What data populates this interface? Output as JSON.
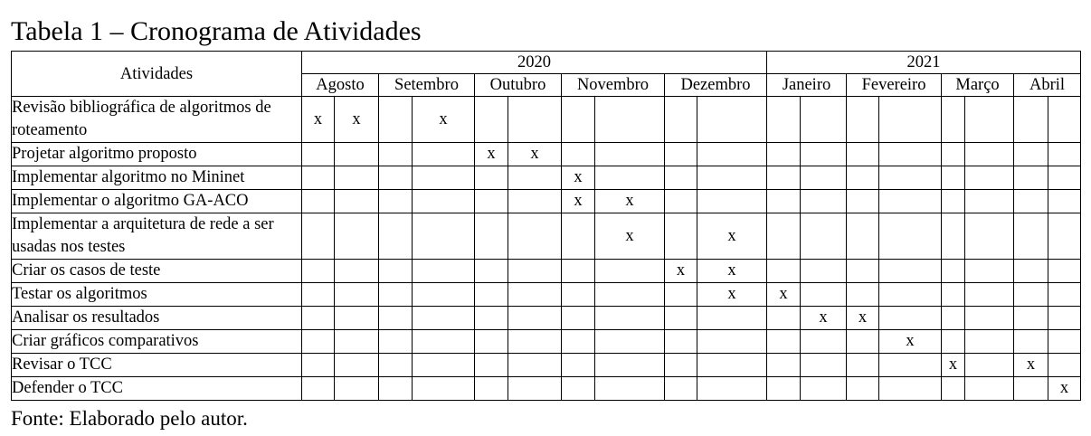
{
  "caption": "Tabela 1 – Cronograma de Atividades",
  "header": {
    "activities_label": "Atividades",
    "years": [
      "2020",
      "2021"
    ],
    "months": [
      "Agosto",
      "Setembro",
      "Outubro",
      "Novembro",
      "Dezembro",
      "Janeiro",
      "Fevereiro",
      "Março",
      "Abril"
    ]
  },
  "rows": [
    {
      "label": "Revisão bibliográfica de algoritmos de roteamento",
      "marks": [
        "x",
        "x",
        "",
        "x",
        "",
        "",
        "",
        "",
        "",
        "",
        "",
        "",
        "",
        "",
        "",
        "",
        "",
        ""
      ]
    },
    {
      "label": "Projetar algoritmo proposto",
      "marks": [
        "",
        "",
        "",
        "",
        "x",
        "x",
        "",
        "",
        "",
        "",
        "",
        "",
        "",
        "",
        "",
        "",
        "",
        ""
      ]
    },
    {
      "label": "Implementar algoritmo no Mininet",
      "marks": [
        "",
        "",
        "",
        "",
        "",
        "",
        "x",
        "",
        "",
        "",
        "",
        "",
        "",
        "",
        "",
        "",
        "",
        ""
      ]
    },
    {
      "label": "Implementar o algoritmo GA-ACO",
      "marks": [
        "",
        "",
        "",
        "",
        "",
        "",
        "x",
        "x",
        "",
        "",
        "",
        "",
        "",
        "",
        "",
        "",
        "",
        ""
      ]
    },
    {
      "label": "Implementar a arquitetura de rede a ser usadas nos testes",
      "marks": [
        "",
        "",
        "",
        "",
        "",
        "",
        "",
        "x",
        "",
        "x",
        "",
        "",
        "",
        "",
        "",
        "",
        "",
        ""
      ]
    },
    {
      "label": "Criar os casos de teste",
      "marks": [
        "",
        "",
        "",
        "",
        "",
        "",
        "",
        "",
        "x",
        "x",
        "",
        "",
        "",
        "",
        "",
        "",
        "",
        ""
      ]
    },
    {
      "label": "Testar os algoritmos",
      "marks": [
        "",
        "",
        "",
        "",
        "",
        "",
        "",
        "",
        "",
        "x",
        "x",
        "",
        "",
        "",
        "",
        "",
        "",
        ""
      ]
    },
    {
      "label": "Analisar os resultados",
      "marks": [
        "",
        "",
        "",
        "",
        "",
        "",
        "",
        "",
        "",
        "",
        "",
        "x",
        "x",
        "",
        "",
        "",
        "",
        ""
      ]
    },
    {
      "label": "Criar gráficos comparativos",
      "marks": [
        "",
        "",
        "",
        "",
        "",
        "",
        "",
        "",
        "",
        "",
        "",
        "",
        "",
        "x",
        "",
        "",
        "",
        ""
      ]
    },
    {
      "label": "Revisar o TCC",
      "marks": [
        "",
        "",
        "",
        "",
        "",
        "",
        "",
        "",
        "",
        "",
        "",
        "",
        "",
        "",
        "x",
        "",
        "x",
        ""
      ]
    },
    {
      "label": "Defender o TCC",
      "marks": [
        "",
        "",
        "",
        "",
        "",
        "",
        "",
        "",
        "",
        "",
        "",
        "",
        "",
        "",
        "",
        "",
        "",
        "x"
      ]
    }
  ],
  "source": "Fonte: Elaborado pelo autor."
}
